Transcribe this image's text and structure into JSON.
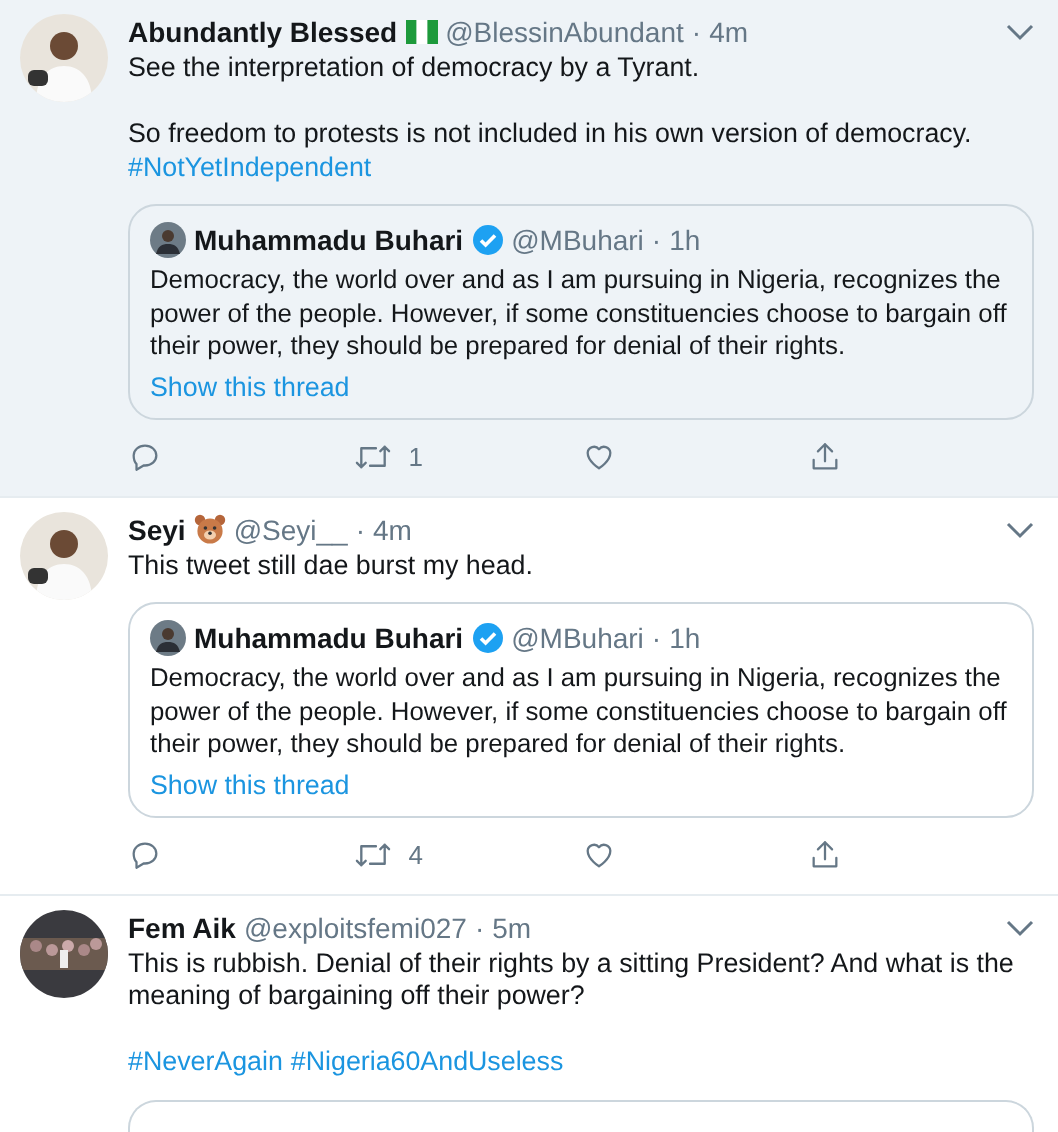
{
  "tweets": [
    {
      "highlighted": true,
      "kind": "flag",
      "name": "Abundantly Blessed",
      "handle": "@BlessinAbundant",
      "separator": "·",
      "time": "4m",
      "body": [
        {
          "kind": "text",
          "text": "See the interpretation of democracy by a Tyrant."
        },
        {
          "kind": "gap"
        },
        {
          "kind": "text",
          "text": "So freedom to protests is not included in his own version of democracy."
        },
        {
          "kind": "tags",
          "tags": [
            "#NotYetIndependent"
          ]
        }
      ],
      "quote": {
        "name": "Muhammadu Buhari",
        "verified": true,
        "handle": "@MBuhari",
        "separator": "·",
        "time": "1h",
        "text": "Democracy, the world over and as I am pursuing in Nigeria, recognizes the power of the people. However, if some constituencies choose to bargain off their power, they should be prepared for denial of their rights.",
        "link": "Show this thread"
      },
      "retweets": "1"
    },
    {
      "highlighted": false,
      "kind": "bear",
      "name": "Seyi",
      "handle": "@Seyi__",
      "separator": "·",
      "time": "4m",
      "body": [
        {
          "kind": "text",
          "text": "This tweet still dae burst my head."
        }
      ],
      "quote": {
        "name": "Muhammadu Buhari",
        "verified": true,
        "handle": "@MBuhari",
        "separator": "·",
        "time": "1h",
        "text": "Democracy, the world over and as I am pursuing in Nigeria, recognizes the power of the people. However, if some constituencies choose to bargain off their power, they should be prepared for denial of their rights.",
        "link": "Show this thread"
      },
      "retweets": "4"
    },
    {
      "highlighted": false,
      "kind": "plain",
      "name": "Fem Aik",
      "handle": "@exploitsfemi027",
      "separator": "·",
      "time": "5m",
      "body": [
        {
          "kind": "text",
          "text": "This is rubbish. Denial of their rights by a sitting President? And what is the meaning of bargaining off their power?"
        },
        {
          "kind": "gap"
        },
        {
          "kind": "tags",
          "tags": [
            "#NeverAgain",
            "#Nigeria60AndUseless"
          ]
        }
      ],
      "quote_cut": true
    }
  ]
}
